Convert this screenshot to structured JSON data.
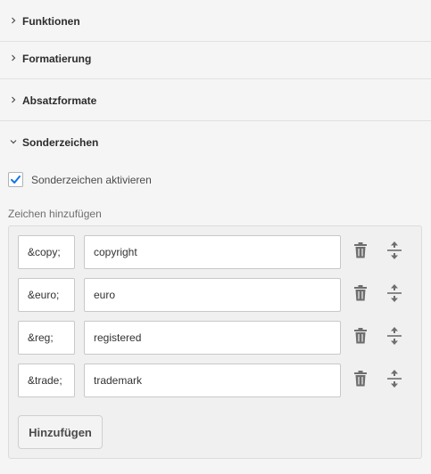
{
  "sections": [
    {
      "title": "Funktionen",
      "expanded": false
    },
    {
      "title": "Formatierung",
      "expanded": false
    },
    {
      "title": "Absatzformate",
      "expanded": false
    },
    {
      "title": "Sonderzeichen",
      "expanded": true
    }
  ],
  "special_chars": {
    "enable_checkbox": {
      "label": "Sonderzeichen aktivieren",
      "checked": true
    },
    "add_label": "Zeichen hinzufügen",
    "rows": [
      {
        "code": "&copy;",
        "name": "copyright"
      },
      {
        "code": "&euro;",
        "name": "euro"
      },
      {
        "code": "&reg;",
        "name": "registered"
      },
      {
        "code": "&trade;",
        "name": "trademark"
      }
    ],
    "add_button_label": "Hinzufügen"
  },
  "icons": {
    "collapsed": "chevron-right-icon",
    "expanded": "chevron-down-icon",
    "delete": "trash-icon",
    "reorder": "move-vertical-icon",
    "checked": "checkmark-icon"
  },
  "colors": {
    "background": "#f5f5f5",
    "checkbox_accent": "#1473e6",
    "icon": "#6e6e6e"
  }
}
